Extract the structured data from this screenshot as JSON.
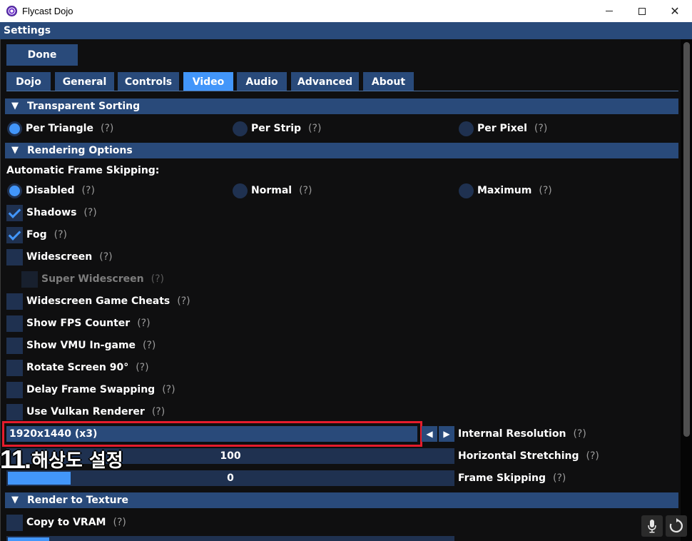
{
  "window": {
    "title": "Flycast Dojo"
  },
  "header": {
    "title": "Settings"
  },
  "toolbar": {
    "done_label": "Done"
  },
  "tabs": [
    {
      "label": "Dojo"
    },
    {
      "label": "General"
    },
    {
      "label": "Controls"
    },
    {
      "label": "Video",
      "active": true
    },
    {
      "label": "Audio"
    },
    {
      "label": "Advanced"
    },
    {
      "label": "About"
    }
  ],
  "help_marker": "(?)",
  "transparent_sorting": {
    "title": "Transparent Sorting",
    "options": [
      {
        "label": "Per Triangle",
        "selected": true
      },
      {
        "label": "Per Strip",
        "selected": false
      },
      {
        "label": "Per Pixel",
        "selected": false
      }
    ]
  },
  "rendering_options": {
    "title": "Rendering Options",
    "frame_skipping_label": "Automatic Frame Skipping:",
    "frame_skipping_options": [
      {
        "label": "Disabled",
        "selected": true
      },
      {
        "label": "Normal",
        "selected": false
      },
      {
        "label": "Maximum",
        "selected": false
      }
    ],
    "checkboxes": [
      {
        "label": "Shadows",
        "checked": true
      },
      {
        "label": "Fog",
        "checked": true
      },
      {
        "label": "Widescreen",
        "checked": false
      },
      {
        "label": "Super Widescreen",
        "checked": false,
        "disabled": true
      },
      {
        "label": "Widescreen Game Cheats",
        "checked": false
      },
      {
        "label": "Show FPS Counter",
        "checked": false
      },
      {
        "label": "Show VMU In-game",
        "checked": false
      },
      {
        "label": "Rotate Screen 90°",
        "checked": false
      },
      {
        "label": "Delay Frame Swapping",
        "checked": false
      },
      {
        "label": "Use Vulkan Renderer",
        "checked": false
      }
    ],
    "internal_resolution": {
      "value": "1920x1440 (x3)",
      "label": "Internal Resolution"
    },
    "horizontal_stretching": {
      "value": "100",
      "label": "Horizontal Stretching"
    },
    "frame_skipping_slider": {
      "value": "0",
      "label": "Frame Skipping"
    }
  },
  "annotation": {
    "number": "11.",
    "text": "해상도 설정"
  },
  "render_to_texture": {
    "title": "Render to Texture",
    "checkboxes": [
      {
        "label": "Copy to VRAM",
        "checked": false
      }
    ]
  },
  "icons": {
    "app": "flycast-swirl-icon",
    "minimize": "minimize-icon",
    "maximize": "maximize-icon",
    "close": "close-icon",
    "mic": "microphone-icon",
    "refresh": "refresh-icon"
  },
  "colors": {
    "accent": "#4296fa",
    "header_bg": "#294a7a",
    "frame_bg": "#1f3150",
    "highlight_box": "#e51c2c"
  }
}
